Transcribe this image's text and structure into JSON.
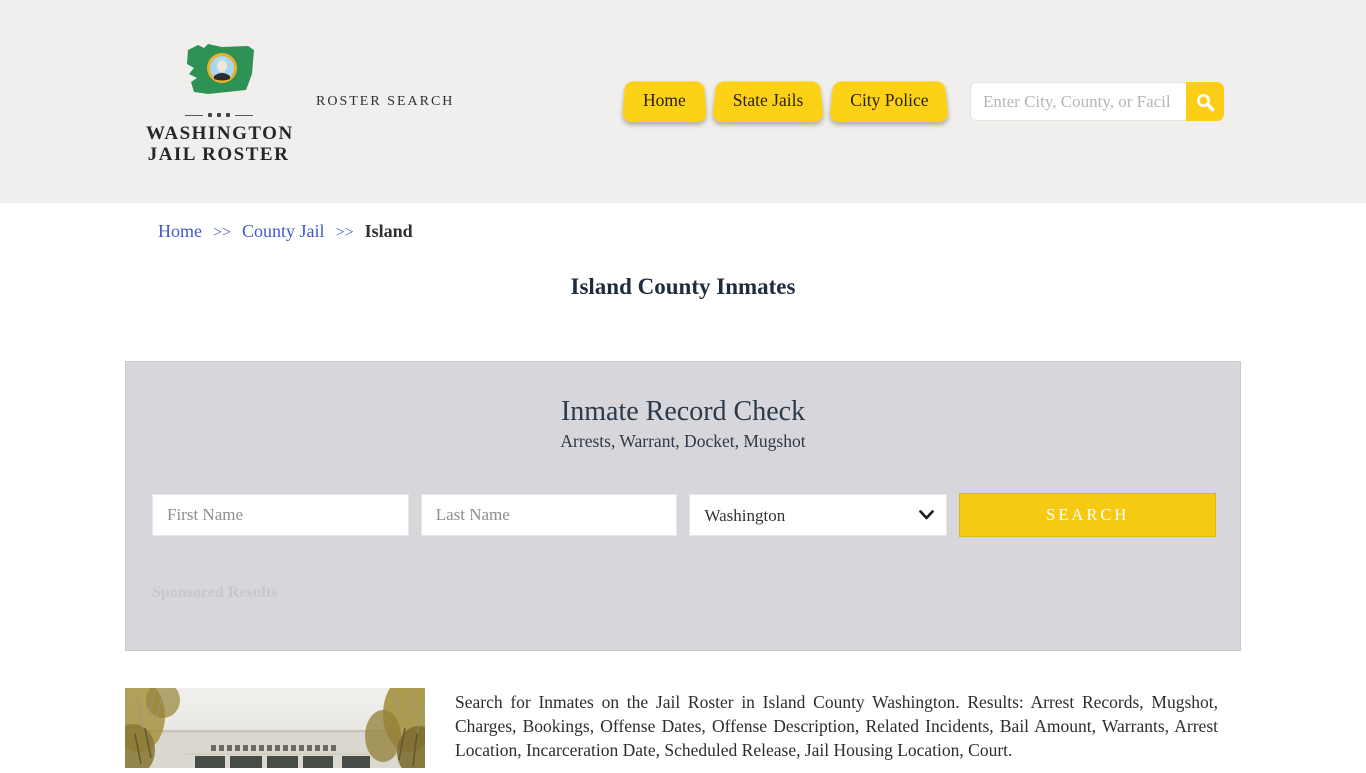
{
  "header": {
    "logo": {
      "line1": "WASHINGTON",
      "line2": "JAIL ROSTER"
    },
    "tagline": "ROSTER SEARCH",
    "nav": [
      {
        "label": "Home"
      },
      {
        "label": "State Jails"
      },
      {
        "label": "City Police"
      }
    ],
    "search": {
      "placeholder": "Enter City, County, or Facil"
    }
  },
  "breadcrumb": {
    "separator": ">>",
    "items": [
      {
        "label": "Home"
      },
      {
        "label": "County Jail"
      },
      {
        "label": "Island"
      }
    ]
  },
  "page": {
    "title": "Island County Inmates",
    "description": "Search for Inmates on the Jail Roster in Island County Washington. Results: Arrest Records, Mugshot, Charges, Bookings, Offense Dates, Offense Description, Related Incidents, Bail Amount, Warrants, Arrest Location, Incarceration Date, Scheduled Release, Jail Housing Location, Court."
  },
  "record_check": {
    "title": "Inmate Record Check",
    "subtitle": "Arrests, Warrant, Docket, Mugshot",
    "first_name_placeholder": "First Name",
    "last_name_placeholder": "Last Name",
    "state_selected": "Washington",
    "search_button": "SEARCH",
    "sponsored_label": "Sponsored Results"
  },
  "icons": {
    "search": "magnifier",
    "state_select": "chevron-down",
    "logo": "washington-state-seal"
  },
  "colors": {
    "accent_yellow": "#fcd116",
    "search_button_yellow": "#f6ca12",
    "link_blue": "#4059c8",
    "header_bg": "#f0efed",
    "panel_bg": "#d7d6db",
    "heading_dark": "#1e2c3c"
  }
}
